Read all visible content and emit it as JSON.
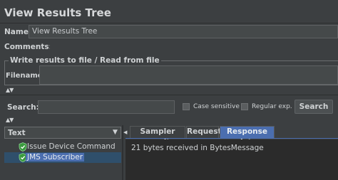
{
  "header": {
    "title": "View Results Tree"
  },
  "name_row": {
    "label": "Name:",
    "value": "View Results Tree"
  },
  "comments_row": {
    "label": "Comments:"
  },
  "file_group": {
    "title": "Write results to file / Read from file",
    "filename_label": "Filename"
  },
  "search": {
    "label": "Search:",
    "value": "",
    "case_sensitive_label": "Case sensitive",
    "regex_label": "Regular exp.",
    "button_label": "Search"
  },
  "renderer": {
    "selected": "Text"
  },
  "tree": {
    "items": [
      {
        "label": "Issue Device Command",
        "icon": "green-shield-check-icon",
        "selected": false
      },
      {
        "label": "JMS Subscriber",
        "icon": "green-shield-check-icon",
        "selected": true
      }
    ]
  },
  "tabs": [
    {
      "label": "Sampler result",
      "active": false
    },
    {
      "label": "Request",
      "active": false
    },
    {
      "label": "Response data",
      "active": true
    }
  ],
  "response": {
    "text": "21 bytes received in BytesMessage"
  },
  "colors": {
    "background": "#3c3f41",
    "accent": "#4b6eaf",
    "success": "#4caf50"
  }
}
